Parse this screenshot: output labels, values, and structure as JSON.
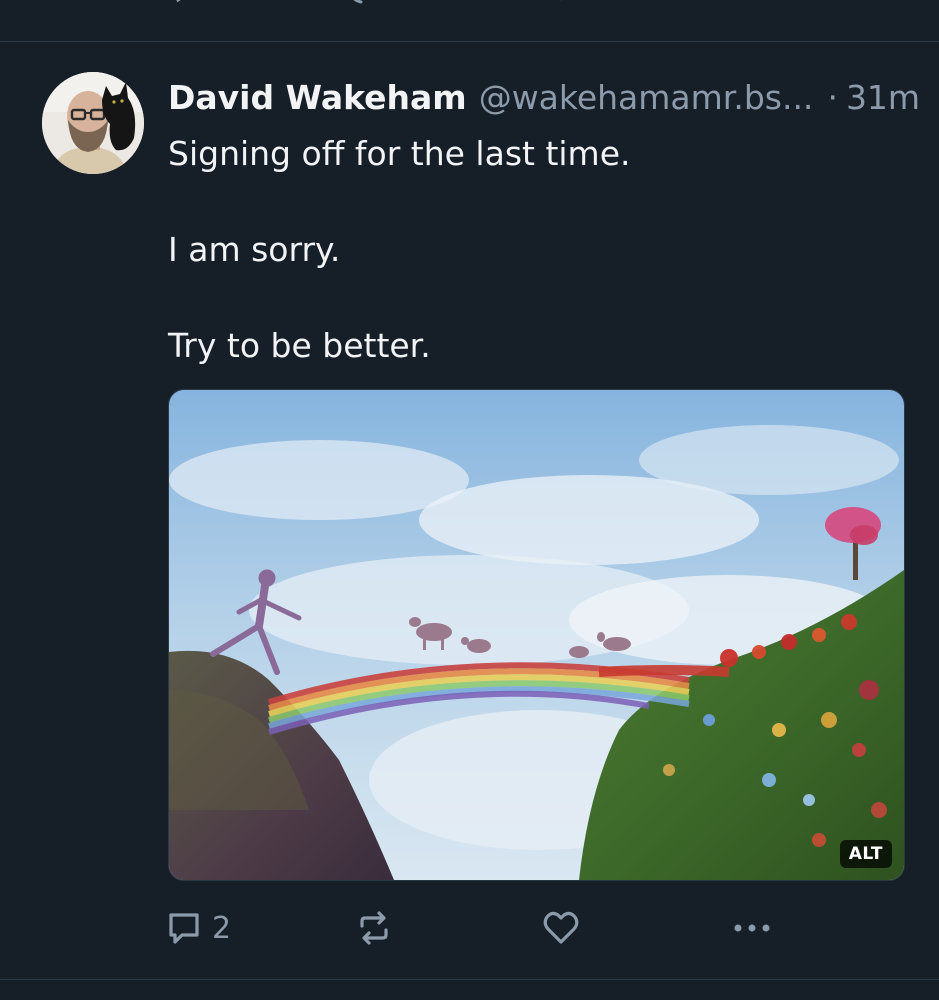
{
  "post": {
    "author": {
      "display_name": "David Wakeham",
      "handle": "@wakehamamr.bs...",
      "avatar_icon": "profile-photo"
    },
    "separator": "·",
    "time": "31m",
    "text_lines": [
      "Signing off for the last time.",
      "I am sorry.",
      "Try to be better."
    ],
    "image": {
      "alt_label": "ALT",
      "icon": "rainbow-bridge-painting"
    },
    "actions": {
      "reply_count": "2",
      "reply_icon": "reply-icon",
      "repost_icon": "repost-icon",
      "like_icon": "heart-icon",
      "more_icon": "more-icon"
    }
  },
  "colors": {
    "background": "#161e27",
    "text": "#f1f3f5",
    "muted": "#8c9bab",
    "divider": "#2c3947"
  }
}
